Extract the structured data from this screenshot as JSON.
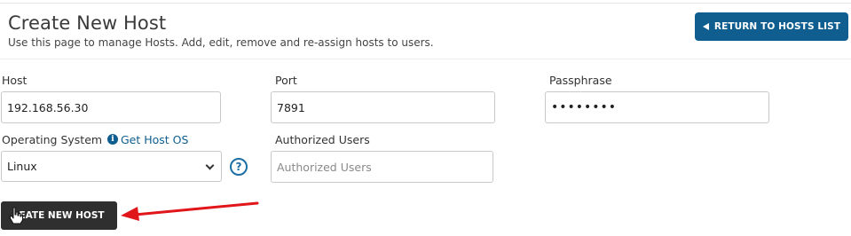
{
  "header": {
    "title": "Create New Host",
    "subtitle": "Use this page to manage Hosts. Add, edit, remove and re-assign hosts to users.",
    "return_button_label": "RETURN TO HOSTS LIST"
  },
  "form": {
    "host": {
      "label": "Host",
      "value": "192.168.56.30"
    },
    "port": {
      "label": "Port",
      "value": "7891"
    },
    "passphrase": {
      "label": "Passphrase",
      "value": "••••••••"
    },
    "operating_system": {
      "label": "Operating System",
      "get_host_os_link": "Get Host OS",
      "selected": "Linux",
      "help_glyph": "?"
    },
    "authorized_users": {
      "label": "Authorized Users",
      "placeholder": "Authorized Users",
      "value": ""
    },
    "submit_label": "EATE NEW HOST"
  },
  "colors": {
    "accent": "#0f5e8f",
    "submit_bg": "#2f2f2f",
    "annotation_arrow": "#e0161b"
  },
  "icons": {
    "return_arrow": "left-triangle-icon",
    "info": "info-icon",
    "help": "help-circle-icon",
    "cursor": "hand-cursor-icon",
    "annotation": "red-arrow-icon"
  }
}
